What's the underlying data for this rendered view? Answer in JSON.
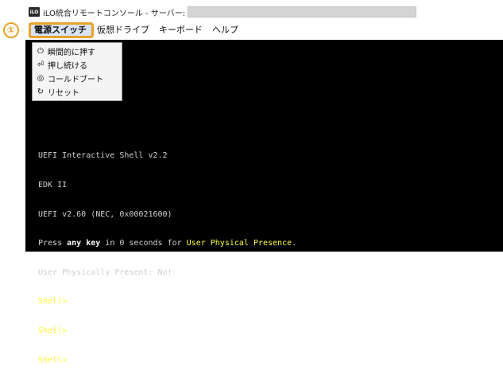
{
  "window": {
    "title": "iLO統合リモートコンソール - サーバー:",
    "icon": "ilo-app-icon"
  },
  "step_marker": "①",
  "menubar": {
    "items": [
      {
        "label": "電源スイッチ",
        "active": true
      },
      {
        "label": "仮想ドライブ",
        "active": false
      },
      {
        "label": "キーボード",
        "active": false
      },
      {
        "label": "ヘルプ",
        "active": false
      }
    ]
  },
  "power_menu": {
    "items": [
      {
        "icon": "power-icon",
        "glyph": "⏻",
        "label": "瞬間的に押す"
      },
      {
        "icon": "press-hold-icon",
        "glyph": "⏎",
        "label": "押し続ける"
      },
      {
        "icon": "cold-boot-icon",
        "glyph": "◎",
        "label": "コールドブート"
      },
      {
        "icon": "reset-icon",
        "glyph": "↻",
        "label": "リセット"
      }
    ]
  },
  "terminal": {
    "line1": "UEFI Interactive Shell v2.2",
    "line2": "EDK II",
    "line3": "UEFI v2.60 (NEC, 0x00021600)",
    "line4_a": "Press ",
    "line4_b": "any key",
    "line4_c": " in 0 seconds for ",
    "line4_d": "User Physical Presence",
    "line4_e": ".",
    "line5": "User Physically Present: No!",
    "prompt1": "Shell>",
    "prompt2": "Shell>",
    "prompt3": "Shell>",
    "cursor": " _"
  },
  "colors": {
    "console_bg": "#000000",
    "console_text": "#cfcfcf",
    "highlight_text": "#ffff3c",
    "annotation": "#e8a32a"
  }
}
